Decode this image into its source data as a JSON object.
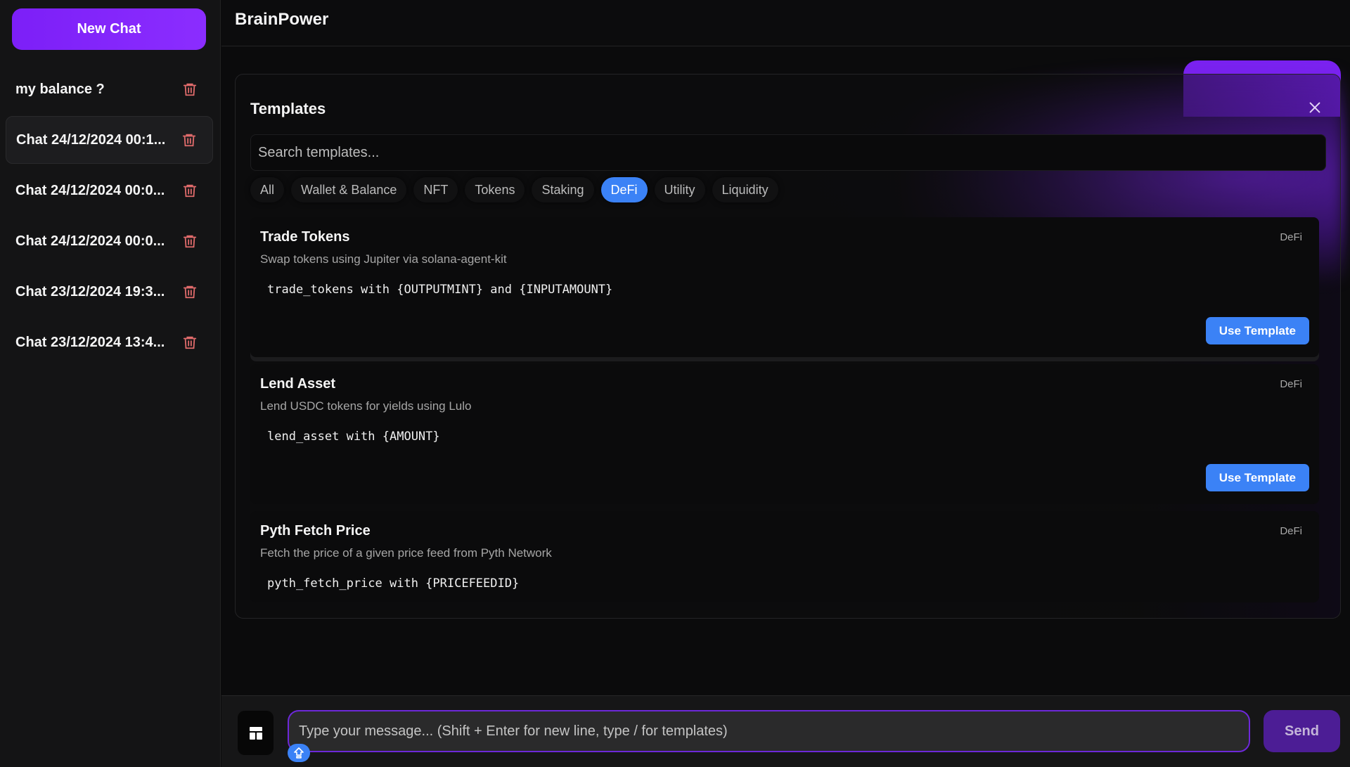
{
  "sidebar": {
    "new_chat_label": "New Chat",
    "chats": [
      {
        "label": "my balance ?",
        "active": false
      },
      {
        "label": "Chat 24/12/2024 00:1...",
        "active": true
      },
      {
        "label": "Chat 24/12/2024 00:0...",
        "active": false
      },
      {
        "label": "Chat 24/12/2024 00:0...",
        "active": false
      },
      {
        "label": "Chat 23/12/2024 19:3...",
        "active": false
      },
      {
        "label": "Chat 23/12/2024 13:4...",
        "active": false
      }
    ]
  },
  "header": {
    "title": "BrainPower"
  },
  "templates_modal": {
    "title": "Templates",
    "close_icon": "close-icon",
    "search": {
      "placeholder": "Search templates...",
      "value": ""
    },
    "filters": [
      {
        "label": "All",
        "active": false
      },
      {
        "label": "Wallet & Balance",
        "active": false
      },
      {
        "label": "NFT",
        "active": false
      },
      {
        "label": "Tokens",
        "active": false
      },
      {
        "label": "Staking",
        "active": false
      },
      {
        "label": "DeFi",
        "active": true
      },
      {
        "label": "Utility",
        "active": false
      },
      {
        "label": "Liquidity",
        "active": false
      }
    ],
    "cards": [
      {
        "title": "Trade Tokens",
        "description": "Swap tokens using Jupiter via solana-agent-kit",
        "code": "trade_tokens with {OUTPUTMINT} and {INPUTAMOUNT}",
        "category": "DeFi",
        "button": "Use Template"
      },
      {
        "title": "Lend Asset",
        "description": "Lend USDC tokens for yields using Lulo",
        "code": "lend_asset with {AMOUNT}",
        "category": "DeFi",
        "button": "Use Template"
      },
      {
        "title": "Pyth Fetch Price",
        "description": "Fetch the price of a given price feed from Pyth Network",
        "code": "pyth_fetch_price with {PRICEFEEDID}",
        "category": "DeFi",
        "button": ""
      }
    ]
  },
  "composer": {
    "templates_icon": "layout-template-icon",
    "input_placeholder": "Type your message... (Shift + Enter for new line, type / for templates)",
    "input_value": "",
    "send_label": "Send",
    "badge_icon": "arrow-up-icon"
  },
  "colors": {
    "accent_purple": "#7c1ff7",
    "accent_blue": "#3b82f6",
    "trash_red": "#e06b6b",
    "send_bg": "#4c1d95"
  }
}
